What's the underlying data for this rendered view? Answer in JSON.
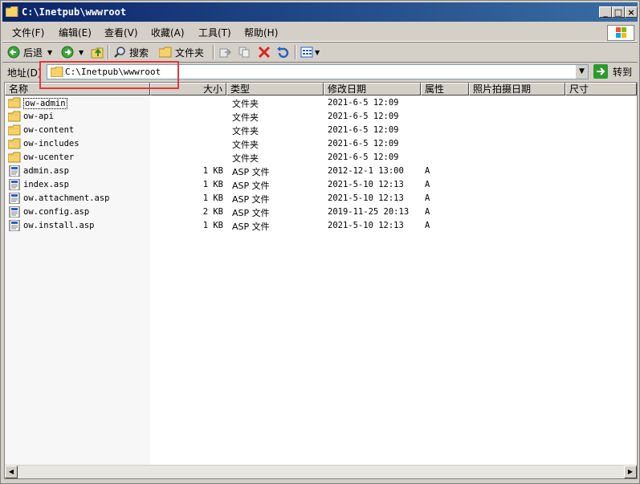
{
  "window": {
    "title": "C:\\Inetpub\\wwwroot",
    "minimize": "_",
    "maximize": "□",
    "close": "×"
  },
  "menu": [
    "文件(F)",
    "编辑(E)",
    "查看(V)",
    "收藏(A)",
    "工具(T)",
    "帮助(H)"
  ],
  "toolbar": {
    "back": "后退",
    "search": "搜索",
    "folders": "文件夹"
  },
  "address": {
    "label": "地址(D)",
    "value": "C:\\Inetpub\\wwwroot",
    "go": "转到"
  },
  "columns": [
    "名称",
    "大小",
    "类型",
    "修改日期",
    "属性",
    "照片拍摄日期",
    "尺寸"
  ],
  "files": [
    {
      "name": "ow-admin",
      "size": "",
      "type": "文件夹",
      "modified": "2021-6-5 12:09",
      "attr": "",
      "kind": "folder"
    },
    {
      "name": "ow-api",
      "size": "",
      "type": "文件夹",
      "modified": "2021-6-5 12:09",
      "attr": "",
      "kind": "folder"
    },
    {
      "name": "ow-content",
      "size": "",
      "type": "文件夹",
      "modified": "2021-6-5 12:09",
      "attr": "",
      "kind": "folder"
    },
    {
      "name": "ow-includes",
      "size": "",
      "type": "文件夹",
      "modified": "2021-6-5 12:09",
      "attr": "",
      "kind": "folder"
    },
    {
      "name": "ow-ucenter",
      "size": "",
      "type": "文件夹",
      "modified": "2021-6-5 12:09",
      "attr": "",
      "kind": "folder"
    },
    {
      "name": "admin.asp",
      "size": "1 KB",
      "type": "ASP 文件",
      "modified": "2012-12-1 13:00",
      "attr": "A",
      "kind": "file"
    },
    {
      "name": "index.asp",
      "size": "1 KB",
      "type": "ASP 文件",
      "modified": "2021-5-10 12:13",
      "attr": "A",
      "kind": "file"
    },
    {
      "name": "ow.attachment.asp",
      "size": "1 KB",
      "type": "ASP 文件",
      "modified": "2021-5-10 12:13",
      "attr": "A",
      "kind": "file"
    },
    {
      "name": "ow.config.asp",
      "size": "2 KB",
      "type": "ASP 文件",
      "modified": "2019-11-25 20:13",
      "attr": "A",
      "kind": "file"
    },
    {
      "name": "ow.install.asp",
      "size": "1 KB",
      "type": "ASP 文件",
      "modified": "2021-5-10 12:13",
      "attr": "A",
      "kind": "file"
    }
  ],
  "colors": {
    "title_start": "#0a246a",
    "title_end": "#3a6ea5",
    "highlight": "#e0393b",
    "folder": "#f5d36a"
  }
}
